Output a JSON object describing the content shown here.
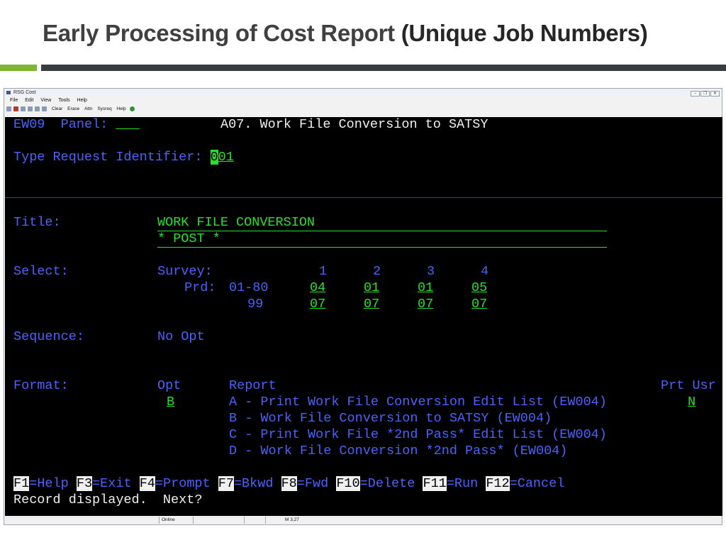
{
  "slide": {
    "title_main": "Early Processing of Cost Report",
    "title_paren": "(Unique Job Numbers)"
  },
  "window": {
    "title": "RSG Cost",
    "menu": [
      "File",
      "Edit",
      "View",
      "Tools",
      "Help"
    ],
    "toolbar": [
      "Clear",
      "Erase",
      "Attn",
      "Sysreq",
      "Help"
    ]
  },
  "screen": {
    "panel_id": "EW09",
    "panel_label": "Panel:",
    "panel_value": "___",
    "heading": "A07. Work File Conversion to SATSY",
    "request_label": "Type Request Identifier:",
    "request_cursor_char": "0",
    "request_value_rest": "01",
    "title_label": "Title:",
    "title_line1": "WORK FILE CONVERSION",
    "title_line2": "* POST *",
    "select_label": "Select:",
    "survey_label": "Survey:",
    "survey_cols": [
      "1",
      "2",
      "3",
      "4"
    ],
    "prd_label": "Prd:",
    "prd_range": "01-80",
    "prd_values": [
      "04",
      "01",
      "01",
      "05"
    ],
    "prd2_label": "99",
    "prd2_values": [
      "07",
      "07",
      "07",
      "07"
    ],
    "sequence_label": "Sequence:",
    "sequence_value": "No Opt",
    "format_label": "Format:",
    "opt_header": "Opt",
    "report_header": "Report",
    "prt_usr_header": "Prt Usr",
    "opt_value": "B",
    "reports": [
      "A - Print Work File Conversion Edit List (EW004)",
      "B - Work File Conversion to SATSY (EW004)",
      "C - Print Work File *2nd Pass* Edit List (EW004)",
      "D - Work File Conversion *2nd Pass* (EW004)"
    ],
    "prt_value": "N",
    "fkeys": [
      {
        "key": "F1",
        "label": "=Help"
      },
      {
        "key": "F3",
        "label": "=Exit"
      },
      {
        "key": "F4",
        "label": "=Prompt"
      },
      {
        "key": "F7",
        "label": "=Bkwd"
      },
      {
        "key": "F8",
        "label": "=Fwd"
      },
      {
        "key": "F10",
        "label": "=Delete"
      },
      {
        "key": "F11",
        "label": "=Run"
      },
      {
        "key": "F12",
        "label": "=Cancel"
      }
    ],
    "message": "Record displayed.  Next?"
  },
  "status": {
    "connection": "Online",
    "mode": "M",
    "cursor_pos": "3,27"
  }
}
